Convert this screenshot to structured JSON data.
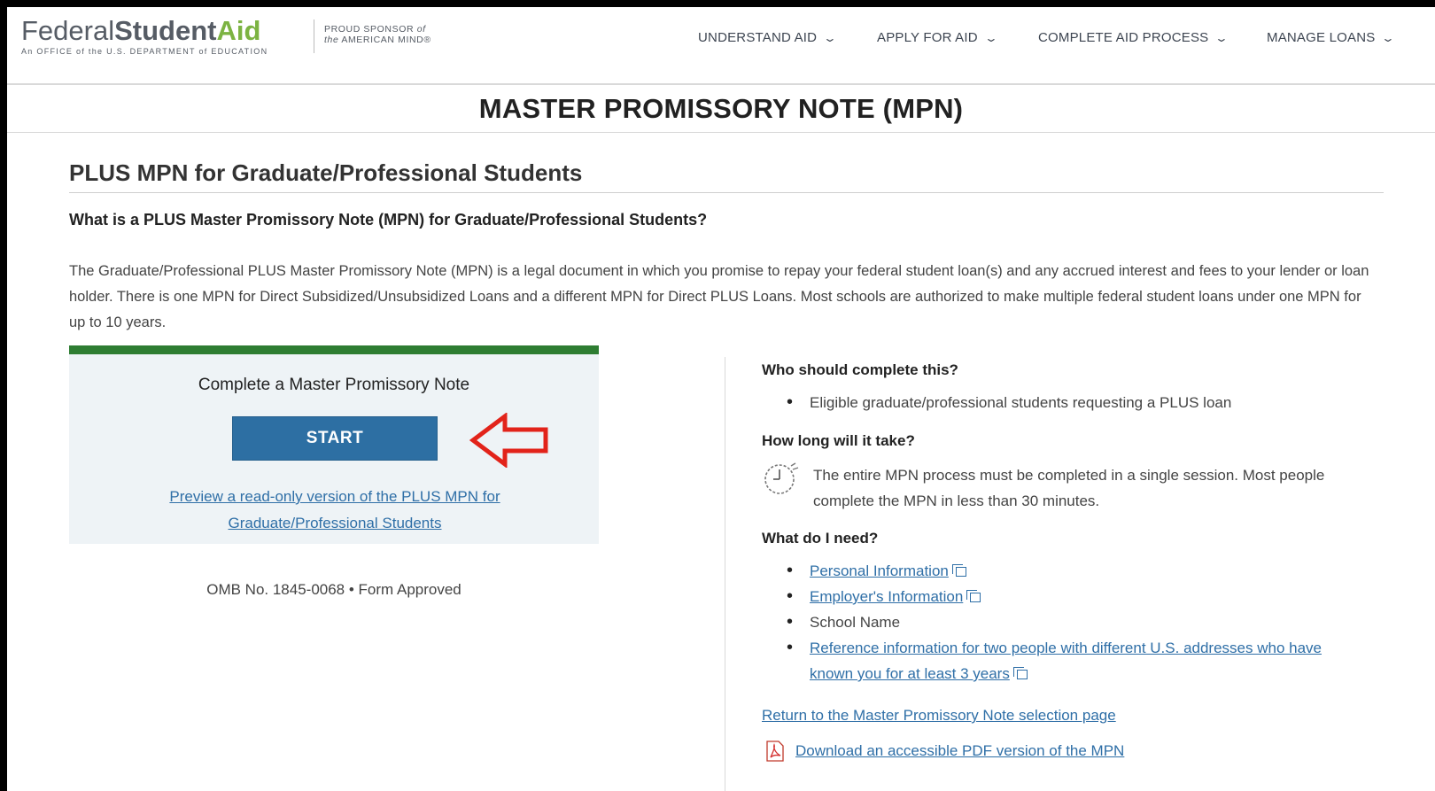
{
  "header": {
    "logo": {
      "federal": "Federal",
      "student": "Student",
      "aid": "Aid",
      "subtitle": "An OFFICE of the U.S. DEPARTMENT of EDUCATION"
    },
    "sponsor": {
      "line1": "PROUD SPONSOR",
      "line1_of": "of",
      "line2_the": "the",
      "line2": "AMERICAN MIND®"
    },
    "nav": [
      {
        "label": "UNDERSTAND AID"
      },
      {
        "label": "APPLY FOR AID"
      },
      {
        "label": "COMPLETE AID PROCESS"
      },
      {
        "label": "MANAGE LOANS"
      }
    ],
    "chevron_icon": "chevron-down-icon"
  },
  "page": {
    "title": "MASTER PROMISSORY NOTE (MPN)",
    "section_title": "PLUS MPN for Graduate/Professional Students",
    "question": "What is a PLUS Master Promissory Note (MPN) for Graduate/Professional Students?",
    "intro": "The Graduate/Professional PLUS Master Promissory Note (MPN) is a legal document in which you promise to repay your federal student loan(s) and any accrued interest and fees to your lender or loan holder. There is one MPN for Direct Subsidized/Unsubsidized Loans and a different MPN for Direct PLUS Loans. Most schools are authorized to make multiple federal student loans under one MPN for up to 10 years."
  },
  "card": {
    "heading": "Complete a Master Promissory Note",
    "start_label": "START",
    "preview_link": "Preview a read-only version of the PLUS MPN for Graduate/Professional Students",
    "omb": "OMB No. 1845-0068 • Form Approved",
    "accent_color": "#2e7d32",
    "button_color": "#2d6fa3",
    "arrow_color": "#e2231a"
  },
  "right": {
    "who_heading": "Who should complete this?",
    "who_items": [
      "Eligible graduate/professional students requesting a PLUS loan"
    ],
    "time_heading": "How long will it take?",
    "time_text": "The entire MPN process must be completed in a single session. Most people complete the MPN in less than 30 minutes.",
    "need_heading": "What do I need?",
    "need_items": [
      {
        "label": "Personal Information",
        "link": true
      },
      {
        "label": "Employer's Information",
        "link": true
      },
      {
        "label": "School Name",
        "link": false
      },
      {
        "label": "Reference information for two people with different U.S. addresses who have known you for at least 3 years",
        "link": true
      }
    ],
    "return_link": "Return to the Master Promissory Note selection page",
    "pdf_link": "Download an accessible PDF version of the MPN",
    "link_color": "#2f6fa7"
  }
}
